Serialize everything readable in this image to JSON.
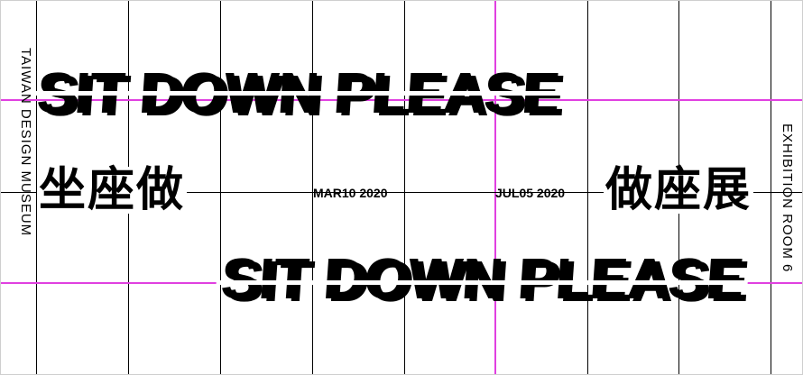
{
  "poster": {
    "headline_top": "SIT DOWN PLEASE",
    "headline_bottom": "SIT DOWN PLEASE",
    "cjk_left": "坐座做",
    "cjk_right": "做座展",
    "date_start": "MAR10 2020",
    "date_end": "JUL05 2020",
    "side_left": "TAIWAN DESIGN MUSEUM",
    "side_right": "EXHIBITION ROOM 6"
  },
  "colors": {
    "grid_black": "#000000",
    "grid_pink": "#e040e0",
    "text": "#000000",
    "background": "#ffffff"
  }
}
